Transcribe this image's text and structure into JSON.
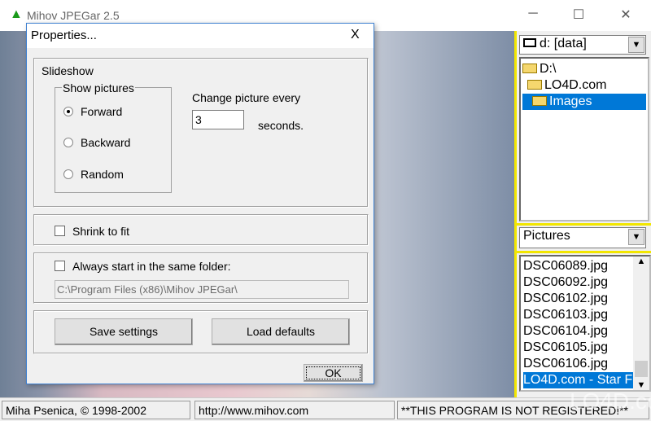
{
  "app": {
    "title": "Mihov JPEGar 2.5",
    "minimize": "─",
    "maximize": "☐",
    "close": "✕"
  },
  "right_panel": {
    "drive": "d: [data]",
    "folders": [
      "D:\\",
      "LO4D.com",
      "Images"
    ],
    "selected_folder": "Images",
    "filter": "Pictures",
    "files": [
      "DSC06089.jpg",
      "DSC06092.jpg",
      "DSC06102.jpg",
      "DSC06103.jpg",
      "DSC06104.jpg",
      "DSC06105.jpg",
      "DSC06106.jpg",
      "LO4D.com - Star F"
    ],
    "selected_file": "LO4D.com - Star F",
    "highlight_color": "#f2e600"
  },
  "status": {
    "author": "Miha Psenica, © 1998-2002",
    "url": "http://www.mihov.com",
    "registration": "**THIS PROGRAM IS NOT REGISTERED!**"
  },
  "dialog": {
    "title": "Properties...",
    "close": "X",
    "slideshow_label": "Slideshow",
    "show_pictures_label": "Show pictures",
    "options": [
      "Forward",
      "Backward",
      "Random"
    ],
    "selected_option": "Forward",
    "change_every_label": "Change picture every",
    "interval": "3",
    "seconds_label": "seconds.",
    "shrink_label": "Shrink to fit",
    "shrink_checked": false,
    "same_folder_label": "Always start in the same folder:",
    "same_folder_checked": false,
    "folder_path": "C:\\Program Files (x86)\\Mihov JPEGar\\",
    "save_label": "Save settings",
    "load_label": "Load defaults",
    "ok_label": "OK"
  },
  "watermark": "LO4D.com"
}
